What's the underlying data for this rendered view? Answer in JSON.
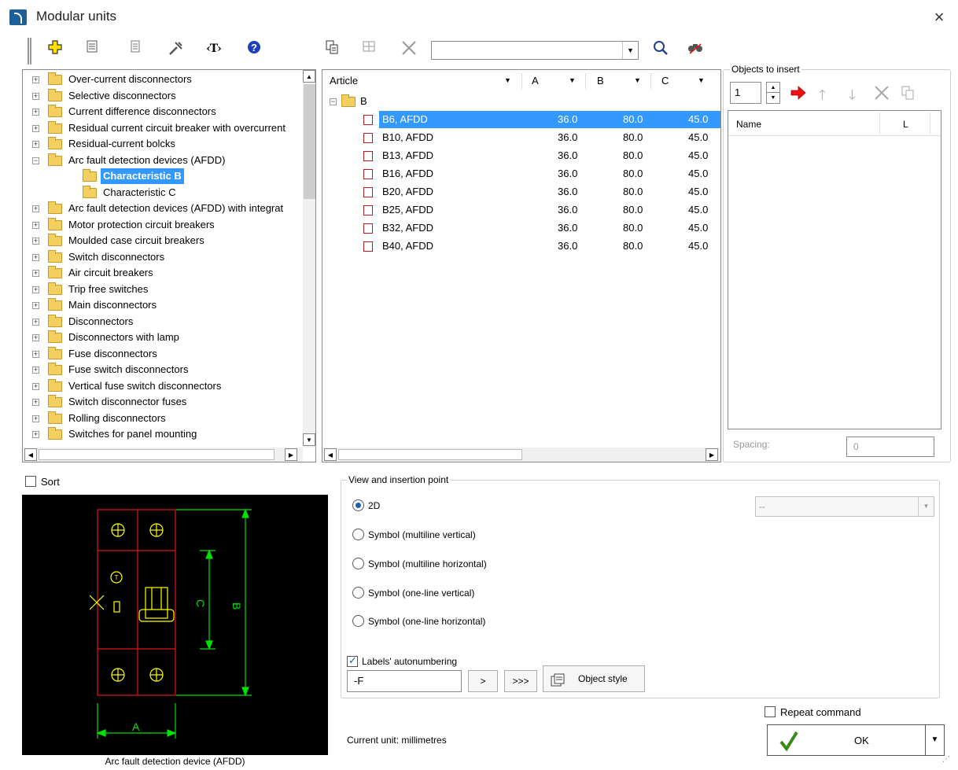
{
  "window": {
    "title": "Modular units",
    "close_label": "×"
  },
  "toolbar": {
    "search_value": "",
    "buttons": [
      "add-icon",
      "properties-icon",
      "list-icon",
      "tools-icon",
      "text-icon",
      "help-icon",
      "copy-icon",
      "table-icon",
      "delete-icon",
      "search-icon",
      "find-icon"
    ]
  },
  "tree": {
    "items": [
      {
        "label": "Over-current disconnectors",
        "level": 0,
        "expander": "+"
      },
      {
        "label": "Selective disconnectors",
        "level": 0,
        "expander": "+"
      },
      {
        "label": "Current difference disconnectors",
        "level": 0,
        "expander": "+"
      },
      {
        "label": "Residual current circuit breaker with overcurrent",
        "level": 0,
        "expander": "+"
      },
      {
        "label": "Residual-current bolcks",
        "level": 0,
        "expander": "+"
      },
      {
        "label": "Arc fault detection devices (AFDD)",
        "level": 0,
        "expander": "−"
      },
      {
        "label": "Characteristic B",
        "level": 1,
        "selected": true
      },
      {
        "label": "Characteristic C",
        "level": 1
      },
      {
        "label": "Arc fault detection devices (AFDD) with integrat",
        "level": 0,
        "expander": "+"
      },
      {
        "label": "Motor protection circuit breakers",
        "level": 0,
        "expander": "+"
      },
      {
        "label": "Moulded case circuit breakers",
        "level": 0,
        "expander": "+"
      },
      {
        "label": "Switch disconnectors",
        "level": 0,
        "expander": "+"
      },
      {
        "label": "Air circuit breakers",
        "level": 0,
        "expander": "+"
      },
      {
        "label": "Trip free switches",
        "level": 0,
        "expander": "+"
      },
      {
        "label": "Main disconnectors",
        "level": 0,
        "expander": "+"
      },
      {
        "label": "Disconnectors",
        "level": 0,
        "expander": "+"
      },
      {
        "label": "Disconnectors with lamp",
        "level": 0,
        "expander": "+"
      },
      {
        "label": "Fuse disconnectors",
        "level": 0,
        "expander": "+"
      },
      {
        "label": "Fuse switch disconnectors",
        "level": 0,
        "expander": "+"
      },
      {
        "label": "Vertical fuse switch disconnectors",
        "level": 0,
        "expander": "+"
      },
      {
        "label": "Switch disconnector fuses",
        "level": 0,
        "expander": "+"
      },
      {
        "label": "Rolling disconnectors",
        "level": 0,
        "expander": "+"
      },
      {
        "label": "Switches for panel mounting",
        "level": 0,
        "expander": "+"
      }
    ]
  },
  "articles": {
    "columns": [
      "Article",
      "A",
      "B",
      "C"
    ],
    "group": "B",
    "rows": [
      {
        "name": "B6, AFDD",
        "a": "36.0",
        "b": "80.0",
        "c": "45.0",
        "selected": true
      },
      {
        "name": "B10, AFDD",
        "a": "36.0",
        "b": "80.0",
        "c": "45.0"
      },
      {
        "name": "B13, AFDD",
        "a": "36.0",
        "b": "80.0",
        "c": "45.0"
      },
      {
        "name": "B16, AFDD",
        "a": "36.0",
        "b": "80.0",
        "c": "45.0"
      },
      {
        "name": "B20, AFDD",
        "a": "36.0",
        "b": "80.0",
        "c": "45.0"
      },
      {
        "name": "B25, AFDD",
        "a": "36.0",
        "b": "80.0",
        "c": "45.0"
      },
      {
        "name": "B32, AFDD",
        "a": "36.0",
        "b": "80.0",
        "c": "45.0"
      },
      {
        "name": "B40, AFDD",
        "a": "36.0",
        "b": "80.0",
        "c": "45.0"
      }
    ]
  },
  "objects": {
    "label": "Objects to insert",
    "quantity": "1",
    "columns": [
      "Name",
      "L"
    ],
    "spacing_label": "Spacing:",
    "spacing_value": "0"
  },
  "sort_label": "Sort",
  "view": {
    "label": "View and insertion point",
    "options": [
      "2D",
      "Symbol (multiline vertical)",
      "Symbol (multiline horizontal)",
      "Symbol (one-line vertical)",
      "Symbol (one-line horizontal)"
    ],
    "selected_index": 0,
    "combo_value": "--",
    "autonumber_label": "Labels' autonumbering",
    "prefix": "-F",
    "btn_next": ">",
    "btn_all": ">>>",
    "object_style_label": "Object style"
  },
  "preview": {
    "caption": "Arc fault detection device (AFDD)",
    "dim_a": "A",
    "dim_b": "B",
    "dim_c": "C",
    "colors": {
      "outline": "#e01818",
      "dimension": "#00e000",
      "symbol": "#ffff00"
    }
  },
  "footer": {
    "current_unit": "Current unit: millimetres",
    "repeat_label": "Repeat command",
    "ok_label": "OK"
  }
}
